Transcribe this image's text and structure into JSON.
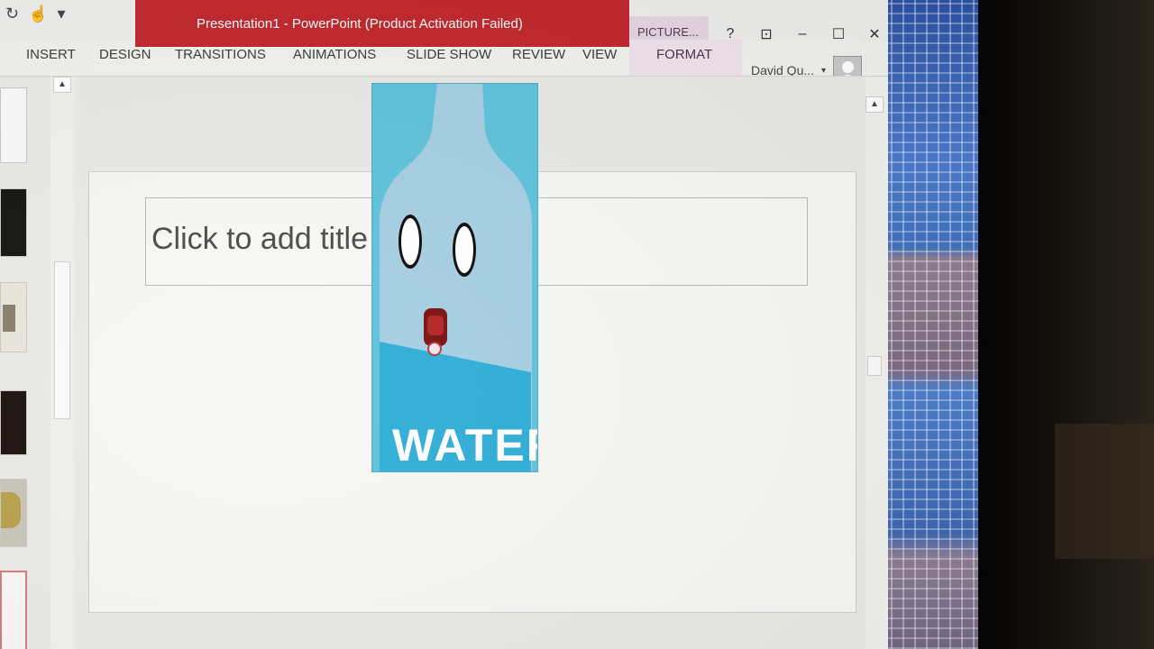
{
  "window": {
    "title": "Presentation1 - PowerPoint (Product Activation Failed)",
    "contextual_tab_group": "PICTURE..."
  },
  "window_controls": {
    "help": "?",
    "restore_ribbon": "⊡",
    "minimize": "–",
    "maximize": "☐",
    "close": "✕"
  },
  "quick_access": {
    "redo": "↻",
    "touch": "☝",
    "customize": "▾"
  },
  "ribbon_tabs": [
    "INSERT",
    "DESIGN",
    "TRANSITIONS",
    "ANIMATIONS",
    "SLIDE SHOW",
    "REVIEW",
    "VIEW"
  ],
  "format_tab": "FORMAT",
  "user": {
    "name": "David Qu...",
    "menu_arrow": "▾"
  },
  "thumbnail_pane": {
    "scroll_up": "▲"
  },
  "slide": {
    "title_placeholder": "Click to add title"
  },
  "picture": {
    "label_text": "WATER"
  },
  "editor_scroll": {
    "scroll_up": "▲"
  },
  "colors": {
    "title_bar_red": "#c0272d",
    "picture_tools_pink": "#e6d4e2",
    "picture_sky": "#5fc3dc"
  }
}
